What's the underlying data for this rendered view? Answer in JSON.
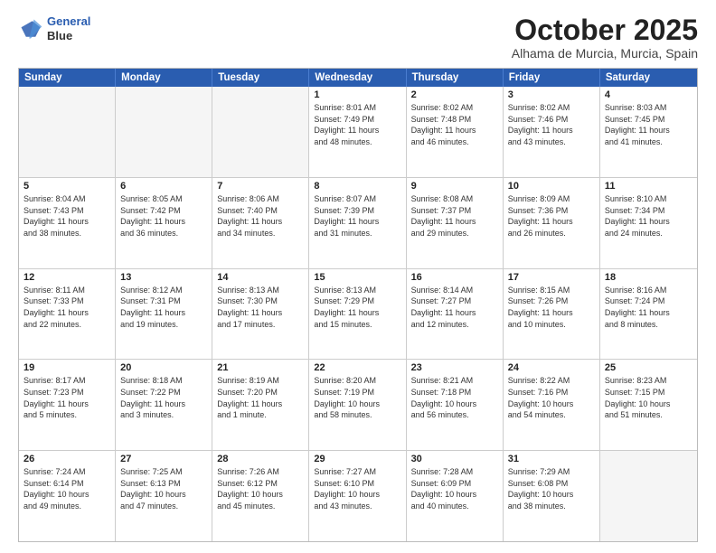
{
  "logo": {
    "line1": "General",
    "line2": "Blue"
  },
  "title": "October 2025",
  "location": "Alhama de Murcia, Murcia, Spain",
  "header_days": [
    "Sunday",
    "Monday",
    "Tuesday",
    "Wednesday",
    "Thursday",
    "Friday",
    "Saturday"
  ],
  "rows": [
    [
      {
        "day": "",
        "info": "",
        "empty": true
      },
      {
        "day": "",
        "info": "",
        "empty": true
      },
      {
        "day": "",
        "info": "",
        "empty": true
      },
      {
        "day": "1",
        "info": "Sunrise: 8:01 AM\nSunset: 7:49 PM\nDaylight: 11 hours\nand 48 minutes."
      },
      {
        "day": "2",
        "info": "Sunrise: 8:02 AM\nSunset: 7:48 PM\nDaylight: 11 hours\nand 46 minutes."
      },
      {
        "day": "3",
        "info": "Sunrise: 8:02 AM\nSunset: 7:46 PM\nDaylight: 11 hours\nand 43 minutes."
      },
      {
        "day": "4",
        "info": "Sunrise: 8:03 AM\nSunset: 7:45 PM\nDaylight: 11 hours\nand 41 minutes."
      }
    ],
    [
      {
        "day": "5",
        "info": "Sunrise: 8:04 AM\nSunset: 7:43 PM\nDaylight: 11 hours\nand 38 minutes."
      },
      {
        "day": "6",
        "info": "Sunrise: 8:05 AM\nSunset: 7:42 PM\nDaylight: 11 hours\nand 36 minutes."
      },
      {
        "day": "7",
        "info": "Sunrise: 8:06 AM\nSunset: 7:40 PM\nDaylight: 11 hours\nand 34 minutes."
      },
      {
        "day": "8",
        "info": "Sunrise: 8:07 AM\nSunset: 7:39 PM\nDaylight: 11 hours\nand 31 minutes."
      },
      {
        "day": "9",
        "info": "Sunrise: 8:08 AM\nSunset: 7:37 PM\nDaylight: 11 hours\nand 29 minutes."
      },
      {
        "day": "10",
        "info": "Sunrise: 8:09 AM\nSunset: 7:36 PM\nDaylight: 11 hours\nand 26 minutes."
      },
      {
        "day": "11",
        "info": "Sunrise: 8:10 AM\nSunset: 7:34 PM\nDaylight: 11 hours\nand 24 minutes."
      }
    ],
    [
      {
        "day": "12",
        "info": "Sunrise: 8:11 AM\nSunset: 7:33 PM\nDaylight: 11 hours\nand 22 minutes."
      },
      {
        "day": "13",
        "info": "Sunrise: 8:12 AM\nSunset: 7:31 PM\nDaylight: 11 hours\nand 19 minutes."
      },
      {
        "day": "14",
        "info": "Sunrise: 8:13 AM\nSunset: 7:30 PM\nDaylight: 11 hours\nand 17 minutes."
      },
      {
        "day": "15",
        "info": "Sunrise: 8:13 AM\nSunset: 7:29 PM\nDaylight: 11 hours\nand 15 minutes."
      },
      {
        "day": "16",
        "info": "Sunrise: 8:14 AM\nSunset: 7:27 PM\nDaylight: 11 hours\nand 12 minutes."
      },
      {
        "day": "17",
        "info": "Sunrise: 8:15 AM\nSunset: 7:26 PM\nDaylight: 11 hours\nand 10 minutes."
      },
      {
        "day": "18",
        "info": "Sunrise: 8:16 AM\nSunset: 7:24 PM\nDaylight: 11 hours\nand 8 minutes."
      }
    ],
    [
      {
        "day": "19",
        "info": "Sunrise: 8:17 AM\nSunset: 7:23 PM\nDaylight: 11 hours\nand 5 minutes."
      },
      {
        "day": "20",
        "info": "Sunrise: 8:18 AM\nSunset: 7:22 PM\nDaylight: 11 hours\nand 3 minutes."
      },
      {
        "day": "21",
        "info": "Sunrise: 8:19 AM\nSunset: 7:20 PM\nDaylight: 11 hours\nand 1 minute."
      },
      {
        "day": "22",
        "info": "Sunrise: 8:20 AM\nSunset: 7:19 PM\nDaylight: 10 hours\nand 58 minutes."
      },
      {
        "day": "23",
        "info": "Sunrise: 8:21 AM\nSunset: 7:18 PM\nDaylight: 10 hours\nand 56 minutes."
      },
      {
        "day": "24",
        "info": "Sunrise: 8:22 AM\nSunset: 7:16 PM\nDaylight: 10 hours\nand 54 minutes."
      },
      {
        "day": "25",
        "info": "Sunrise: 8:23 AM\nSunset: 7:15 PM\nDaylight: 10 hours\nand 51 minutes."
      }
    ],
    [
      {
        "day": "26",
        "info": "Sunrise: 7:24 AM\nSunset: 6:14 PM\nDaylight: 10 hours\nand 49 minutes."
      },
      {
        "day": "27",
        "info": "Sunrise: 7:25 AM\nSunset: 6:13 PM\nDaylight: 10 hours\nand 47 minutes."
      },
      {
        "day": "28",
        "info": "Sunrise: 7:26 AM\nSunset: 6:12 PM\nDaylight: 10 hours\nand 45 minutes."
      },
      {
        "day": "29",
        "info": "Sunrise: 7:27 AM\nSunset: 6:10 PM\nDaylight: 10 hours\nand 43 minutes."
      },
      {
        "day": "30",
        "info": "Sunrise: 7:28 AM\nSunset: 6:09 PM\nDaylight: 10 hours\nand 40 minutes."
      },
      {
        "day": "31",
        "info": "Sunrise: 7:29 AM\nSunset: 6:08 PM\nDaylight: 10 hours\nand 38 minutes."
      },
      {
        "day": "",
        "info": "",
        "empty": true
      }
    ]
  ]
}
